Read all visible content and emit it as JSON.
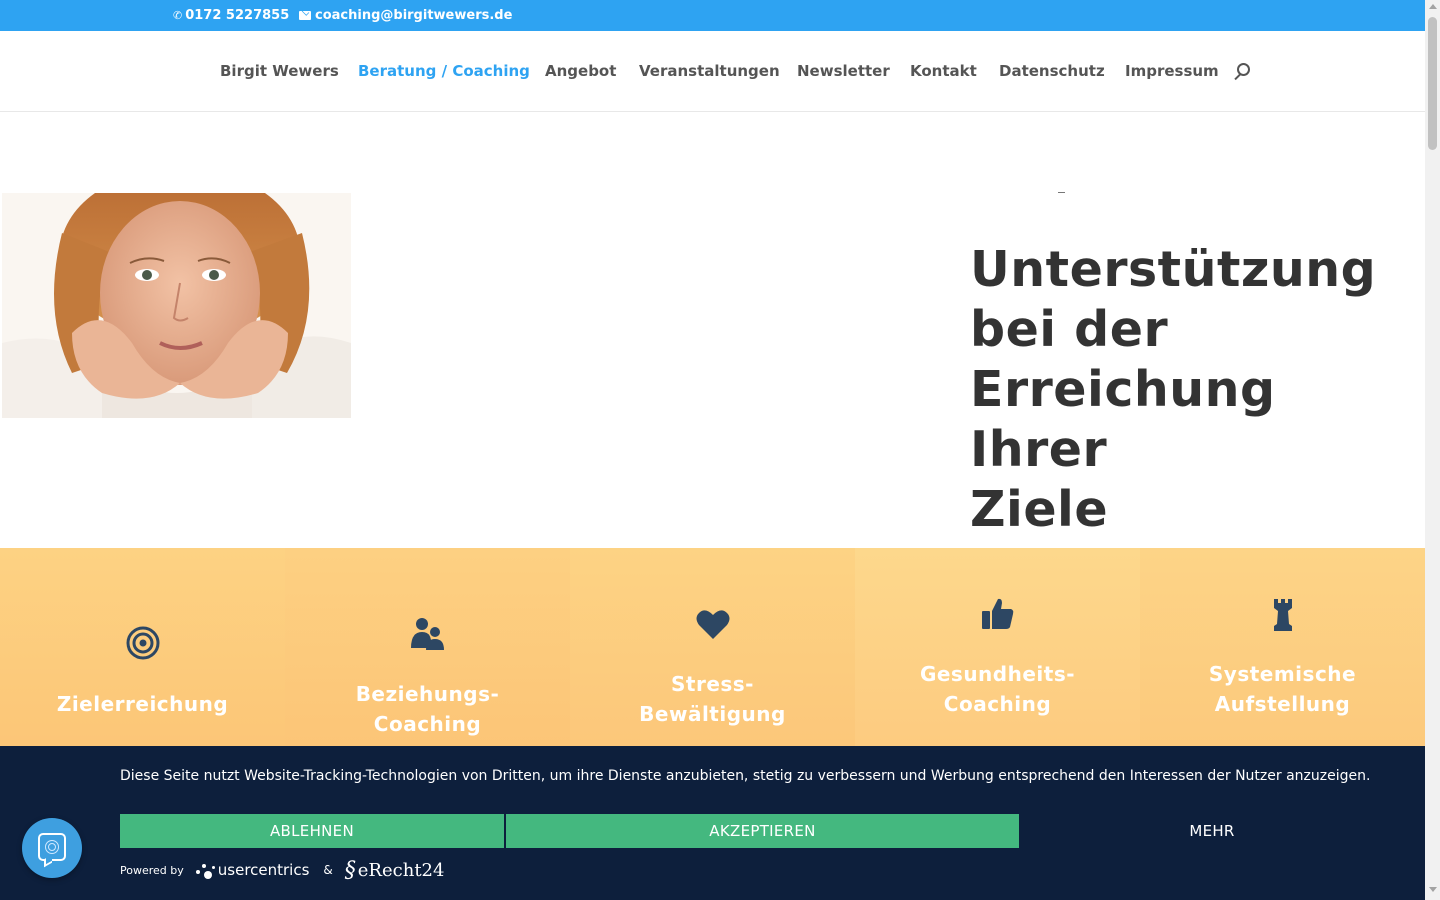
{
  "topbar": {
    "phone": "0172 5227855",
    "email": "coaching@birgitwewers.de",
    "phone_icon": "phone-icon",
    "email_icon": "envelope-icon",
    "bg_color": "#2ea3f2"
  },
  "nav": {
    "items": [
      {
        "label": "Birgit Wewers",
        "active": false
      },
      {
        "label": "Beratung / Coaching",
        "active": true
      },
      {
        "label": "Angebot",
        "active": false
      },
      {
        "label": "Veranstaltungen",
        "active": false
      },
      {
        "label": "Newsletter",
        "active": false
      },
      {
        "label": "Kontakt",
        "active": false
      },
      {
        "label": "Datenschutz",
        "active": false
      },
      {
        "label": "Impressum",
        "active": false
      }
    ],
    "active_color": "#2ea3f2",
    "search_icon": "search-icon"
  },
  "hero": {
    "title_lines": [
      "Unterstützung",
      "bei der",
      "Erreichung Ihrer",
      "Ziele"
    ],
    "image": "portrait-photo"
  },
  "services": {
    "items": [
      {
        "icon": "target-icon",
        "label_lines": [
          "Zielerreichung"
        ]
      },
      {
        "icon": "users-icon",
        "label_lines": [
          "Beziehungs-",
          "Coaching"
        ]
      },
      {
        "icon": "heart-icon",
        "label_lines": [
          "Stress-",
          "Bewältigung"
        ]
      },
      {
        "icon": "thumbs-up-icon",
        "label_lines": [
          "Gesundheits-",
          "Coaching"
        ]
      },
      {
        "icon": "chess-rook-icon",
        "label_lines": [
          "Systemische",
          "Aufstellung"
        ]
      }
    ],
    "bg_color": "#fdc97c",
    "icon_color": "#2d4763"
  },
  "cookie": {
    "message": "Diese Seite nutzt Website-Tracking-Technologien von Dritten, um ihre Dienste anzubieten, stetig zu verbessern und Werbung entsprechend den Interessen der Nutzer anzuzeigen.",
    "decline_label": "ABLEHNEN",
    "accept_label": "AKZEPTIEREN",
    "more_label": "MEHR",
    "powered_by": "Powered by",
    "usercentrics": "usercentrics",
    "ampersand": "&",
    "erecht": "eRecht24",
    "bg_color": "#0d1f3c",
    "button_color": "#44b87f"
  },
  "privacy_button": {
    "icon": "privacy-fingerprint-icon"
  }
}
